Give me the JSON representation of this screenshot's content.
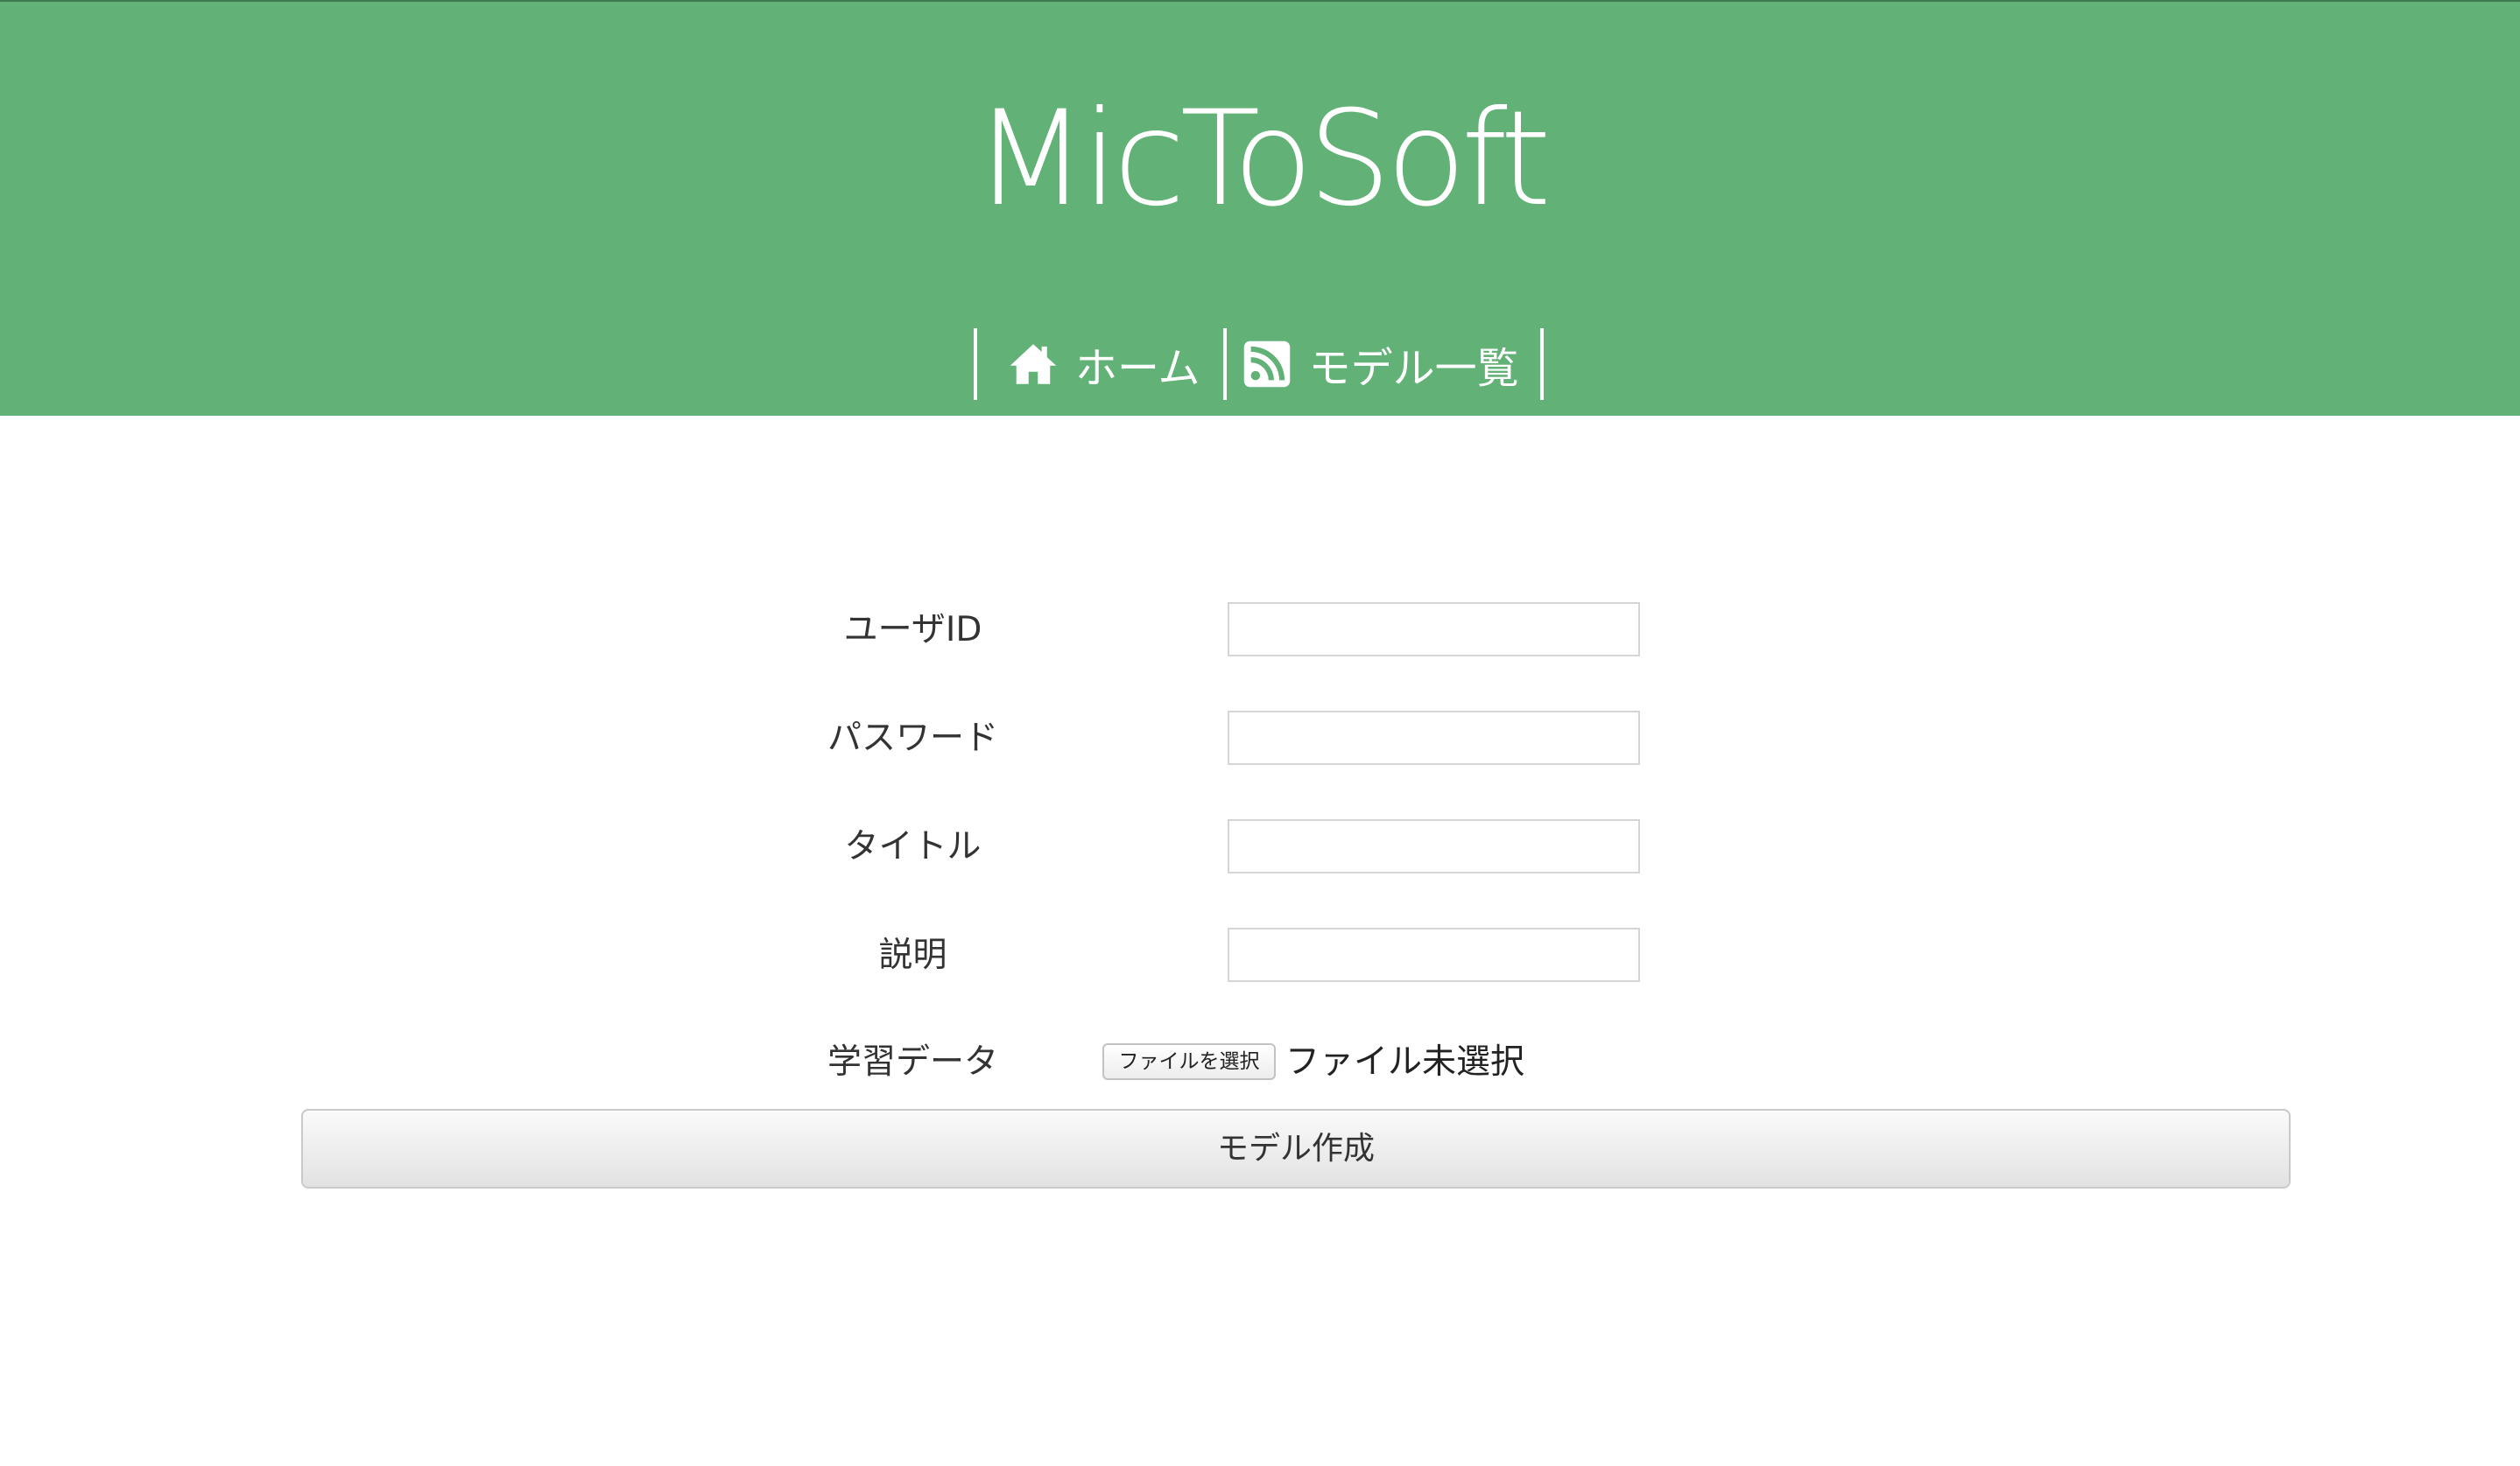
{
  "header": {
    "title": "MicToSoft",
    "background_color": "#62b177"
  },
  "nav": {
    "items": [
      {
        "label": "ホーム",
        "icon": "home-icon"
      },
      {
        "label": "モデル一覧",
        "icon": "rss-icon"
      }
    ]
  },
  "form": {
    "user_id": {
      "label": "ユーザID",
      "value": ""
    },
    "password": {
      "label": "パスワード",
      "value": ""
    },
    "title": {
      "label": "タイトル",
      "value": ""
    },
    "description": {
      "label": "説明",
      "value": ""
    },
    "training_data": {
      "label": "学習データ",
      "button_label": "ファイルを選択",
      "status": "ファイル未選択"
    },
    "submit_label": "モデル作成"
  }
}
